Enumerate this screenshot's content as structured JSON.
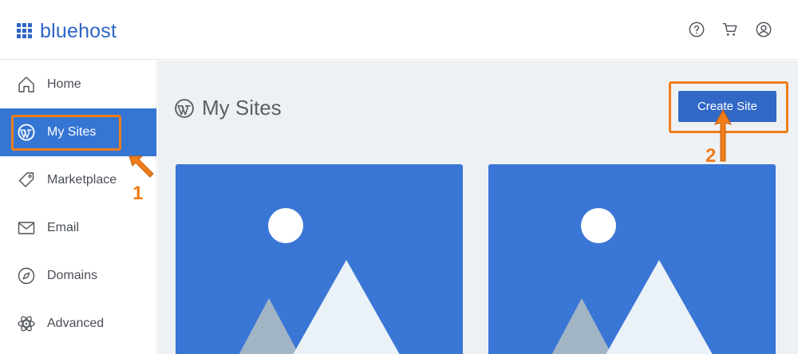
{
  "brand": {
    "name": "bluehost",
    "color": "#2f65c6"
  },
  "header": {
    "icons": [
      "help-icon",
      "cart-icon",
      "account-icon"
    ]
  },
  "sidebar": {
    "active_color": "#3575d3",
    "items": [
      {
        "label": "Home",
        "icon": "home-icon",
        "active": false
      },
      {
        "label": "My Sites",
        "icon": "wordpress-icon",
        "active": true
      },
      {
        "label": "Marketplace",
        "icon": "tag-icon",
        "active": false
      },
      {
        "label": "Email",
        "icon": "envelope-icon",
        "active": false
      },
      {
        "label": "Domains",
        "icon": "compass-icon",
        "active": false
      },
      {
        "label": "Advanced",
        "icon": "atom-icon",
        "active": false
      }
    ]
  },
  "main": {
    "title": "My Sites",
    "create_button_label": "Create Site",
    "site_cards": [
      {
        "thumbnail": "placeholder-image"
      },
      {
        "thumbnail": "placeholder-image"
      }
    ]
  },
  "annotations": {
    "color": "#f07d1a",
    "steps": [
      {
        "number": "1"
      },
      {
        "number": "2"
      }
    ]
  }
}
